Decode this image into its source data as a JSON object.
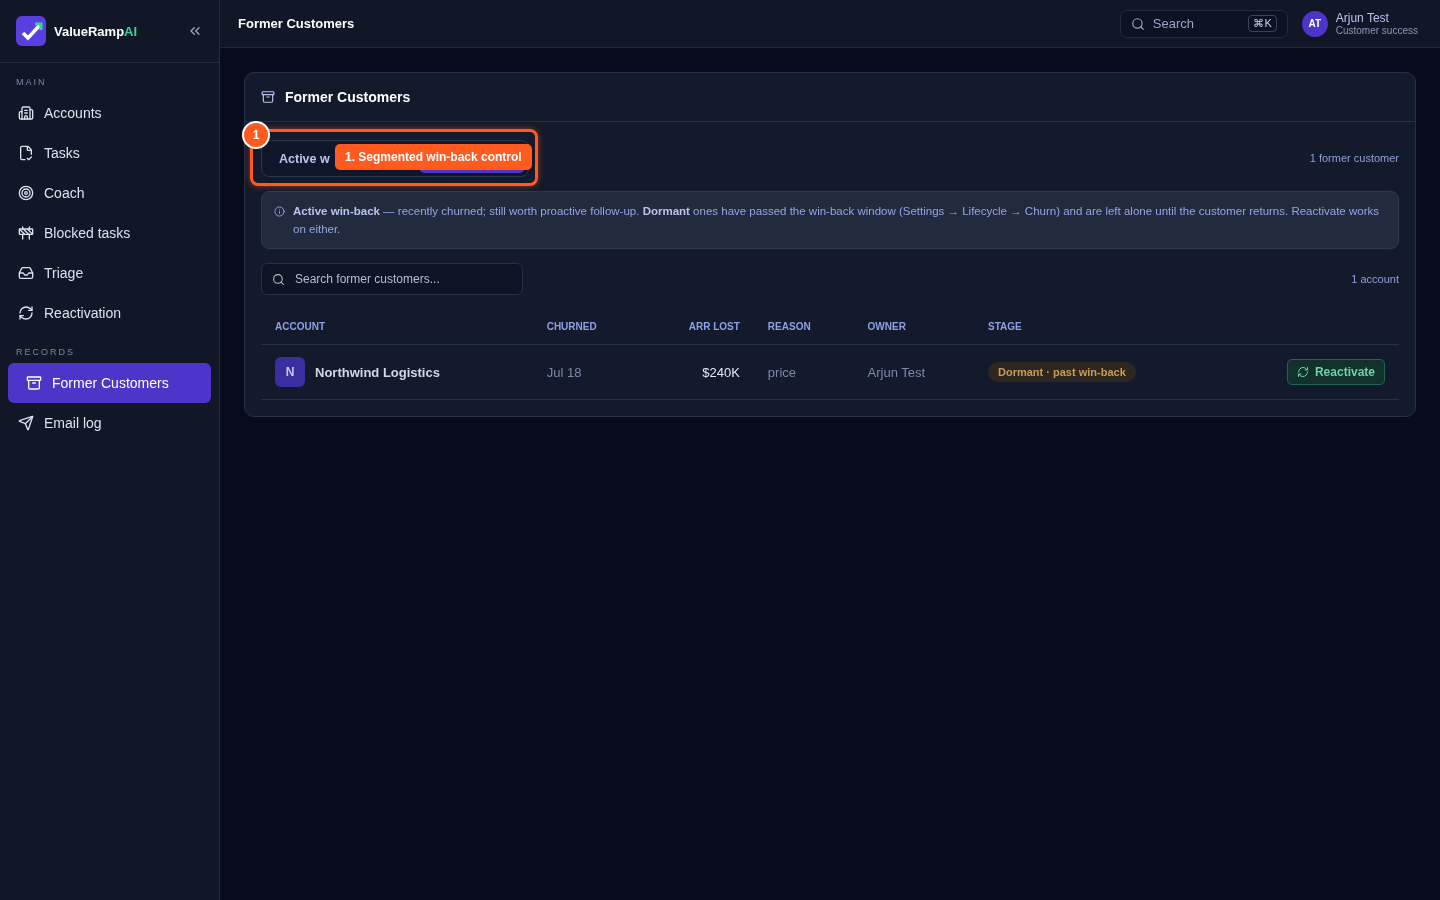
{
  "brand": {
    "name": "ValueRamp",
    "suffix": "AI"
  },
  "sidebar": {
    "sections": [
      {
        "title": "MAIN",
        "items": [
          {
            "label": "Accounts",
            "selected": false
          },
          {
            "label": "Tasks",
            "selected": false
          },
          {
            "label": "Coach",
            "selected": false
          },
          {
            "label": "Blocked tasks",
            "selected": false
          },
          {
            "label": "Triage",
            "selected": false
          },
          {
            "label": "Reactivation",
            "selected": false
          }
        ]
      },
      {
        "title": "RECORDS",
        "items": [
          {
            "label": "Former Customers",
            "selected": true
          },
          {
            "label": "Email log",
            "selected": false
          }
        ]
      }
    ]
  },
  "header": {
    "title": "Former Customers",
    "search": {
      "placeholder": "Search",
      "shortcut": "⌘K"
    },
    "user": {
      "initials": "AT",
      "name": "Arjun Test",
      "role": "Customer success"
    }
  },
  "card": {
    "title": "Former Customers",
    "segments": [
      {
        "label": "Active w",
        "selected": false
      },
      {
        "selected": true
      }
    ],
    "annotation": {
      "number": "1",
      "label": "1. Segmented win-back control"
    },
    "count": "1 former customer",
    "info": "**Active win-back** — recently churned; still worth proactive follow-up. **Dormant** ones have passed the win-back window (Settings → Lifecycle → Churn) and are left alone until the customer returns. Reactivate works on either.",
    "search": {
      "placeholder": "Search former customers..."
    },
    "results": "1 account",
    "table": {
      "columns": [
        "ACCOUNT",
        "CHURNED",
        "ARR LOST",
        "REASON",
        "OWNER",
        "STAGE"
      ],
      "rows": [
        {
          "initial": "N",
          "account": "Northwind Logistics",
          "churned": "Jul 18",
          "arr_lost": "$240K",
          "reason": "price",
          "owner": "Arjun Test",
          "stage": "Dormant · past win-back",
          "action": "Reactivate"
        }
      ]
    }
  }
}
